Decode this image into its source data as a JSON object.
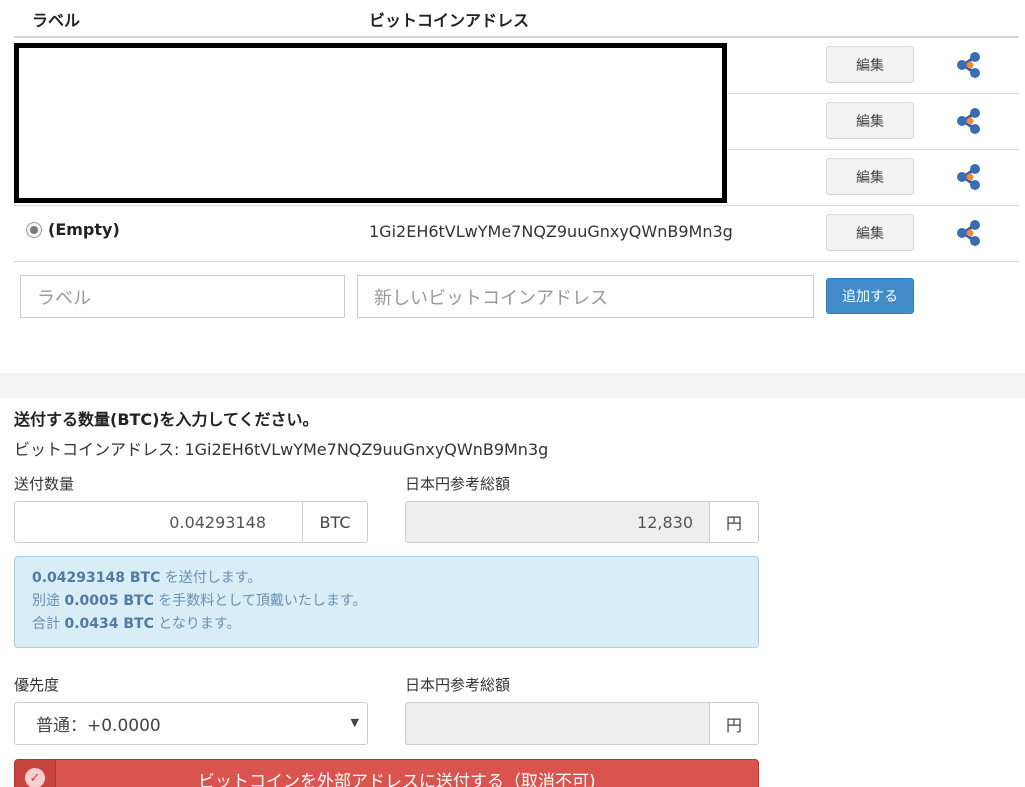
{
  "address_book": {
    "header_label": "ラベル",
    "header_address": "ビットコインアドレス",
    "edit_label": "編集",
    "selected_entry": {
      "label": "(Empty)",
      "address": "1Gi2EH6tVLwYMe7NQZ9uuGnxyQWnB9Mn3g"
    },
    "new_label_placeholder": "ラベル",
    "new_address_placeholder": "新しいビットコインアドレス",
    "add_label": "追加する"
  },
  "send_form": {
    "title": "送付する数量(BTC)を入力してください。",
    "address_line": "ビットコインアドレス: 1Gi2EH6tVLwYMe7NQZ9uuGnxyQWnB9Mn3g",
    "amount_label": "送付数量",
    "amount_value": "0.04293148",
    "amount_unit": "BTC",
    "jpy_label": "日本円参考総額",
    "jpy_value": "12,830",
    "jpy_unit": "円",
    "info": {
      "line1_amount": "0.04293148 BTC",
      "line1_text": " を送付します。",
      "line2_prefix": "別途 ",
      "line2_amount": "0.0005 BTC",
      "line2_text": " を手数料として頂戴いたします。",
      "line3_prefix": "合計 ",
      "line3_amount": "0.0434 BTC",
      "line3_text": " となります。"
    },
    "priority_label": "優先度",
    "priority_value": "普通：+0.0000",
    "fee_jpy_label": "日本円参考総額",
    "fee_jpy_value": "",
    "fee_jpy_unit": "円",
    "send_button": "ビットコインを外部アドレスに送付する（取消不可)"
  },
  "icons": {
    "share": "share-nodes-icon",
    "check": "check-circle-icon",
    "caret": "caret-down-icon"
  }
}
